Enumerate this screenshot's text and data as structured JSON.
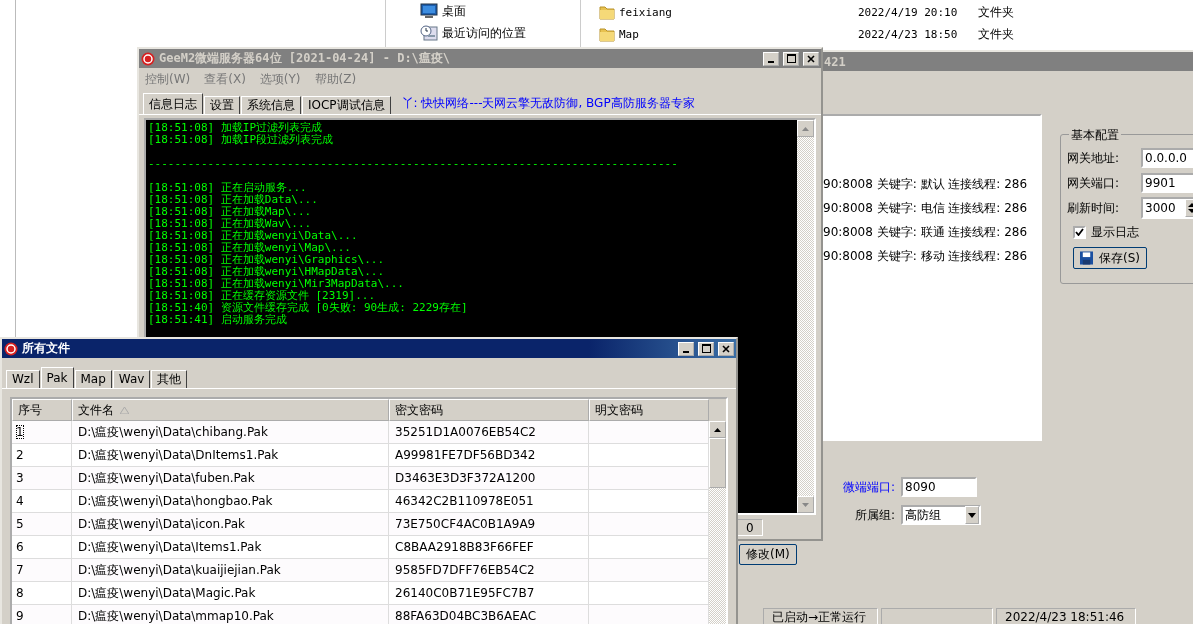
{
  "explorer": {
    "nav_items": [
      {
        "label": "桌面",
        "kind": "desktop"
      },
      {
        "label": "最近访问的位置",
        "kind": "recent"
      }
    ],
    "files": [
      {
        "name": "feixiang",
        "modified": "2022/4/19 20:10",
        "type": "文件夹"
      },
      {
        "name": "Map",
        "modified": "2022/4/23 18:50",
        "type": "文件夹"
      }
    ]
  },
  "gateway_window": {
    "title": "421",
    "connections": [
      "90:8008 关键字: 默认 连接线程: 286",
      "90:8008 关键字: 电信 连接线程: 286",
      "90:8008 关键字: 联通 连接线程: 286",
      "90:8008 关键字: 移动 连接线程: 286"
    ],
    "basic_config": {
      "title": "基本配置",
      "fields": [
        {
          "label": "网关地址:",
          "value": "0.0.0.0",
          "kind": "text"
        },
        {
          "label": "网关端口:",
          "value": "9901",
          "kind": "text"
        },
        {
          "label": "刷新时间:",
          "value": "3000",
          "kind": "spin"
        }
      ],
      "show_log": {
        "label": "显示日志",
        "checked": true
      },
      "save_button": "保存(S)"
    },
    "micro_port": {
      "label": "微端端口:",
      "value": "8090"
    },
    "group": {
      "label": "所属组:",
      "value": "高防组"
    },
    "modify_button": "修改(M)",
    "status_bar": [
      "已启动→正常运行",
      "2022/4/23 18:51:46"
    ]
  },
  "server_window": {
    "title": "GeeM2微端服务器64位 [2021-04-24] - D:\\瘟疫\\",
    "menu": [
      "控制(W)",
      "查看(X)",
      "选项(Y)",
      "帮助(Z)"
    ],
    "tabs": [
      {
        "label": "信息日志",
        "selected": true
      },
      {
        "label": "设置",
        "selected": false
      },
      {
        "label": "系统信息",
        "selected": false
      },
      {
        "label": "IOCP调试信息",
        "selected": false
      }
    ],
    "banner": "丫: 快快网络---天网云擎无敌防御, BGP高防服务器专家",
    "log": [
      {
        "kind": "line",
        "text": "[18:51:08] 加载IP过滤列表完成"
      },
      {
        "kind": "line",
        "text": "[18:51:08] 加载IP段过滤列表完成"
      },
      {
        "kind": "gap"
      },
      {
        "kind": "line",
        "text": "--------------------------------------------------------------------------------"
      },
      {
        "kind": "gap"
      },
      {
        "kind": "line",
        "text": "[18:51:08] 正在启动服务..."
      },
      {
        "kind": "line",
        "text": "[18:51:08] 正在加载Data\\..."
      },
      {
        "kind": "line",
        "text": "[18:51:08] 正在加载Map\\..."
      },
      {
        "kind": "line",
        "text": "[18:51:08] 正在加载Wav\\..."
      },
      {
        "kind": "line",
        "text": "[18:51:08] 正在加载wenyi\\Data\\..."
      },
      {
        "kind": "line",
        "text": "[18:51:08] 正在加载wenyi\\Map\\..."
      },
      {
        "kind": "line",
        "text": "[18:51:08] 正在加载wenyi\\Graphics\\..."
      },
      {
        "kind": "line",
        "text": "[18:51:08] 正在加载wenyi\\HMapData\\..."
      },
      {
        "kind": "line",
        "text": "[18:51:08] 正在加载wenyi\\Mir3MapData\\..."
      },
      {
        "kind": "line",
        "text": "[18:51:08] 正在缓存资源文件 [2319]..."
      },
      {
        "kind": "line",
        "text": "[18:51:40] 资源文件缓存完成 [0失败: 90生成: 2229存在]"
      },
      {
        "kind": "line",
        "text": "[18:51:41] 启动服务完成"
      }
    ],
    "status_bar": [
      "0"
    ]
  },
  "files_window": {
    "title": "所有文件",
    "tabs": [
      {
        "label": "Wzl",
        "selected": false
      },
      {
        "label": "Pak",
        "selected": true
      },
      {
        "label": "Map",
        "selected": false
      },
      {
        "label": "Wav",
        "selected": false
      },
      {
        "label": "其他",
        "selected": false
      }
    ],
    "table": {
      "columns": [
        {
          "label": "序号",
          "sorted": false
        },
        {
          "label": "文件名",
          "sorted": true
        },
        {
          "label": "密文密码",
          "sorted": false
        },
        {
          "label": "明文密码",
          "sorted": false
        }
      ],
      "rows": [
        {
          "index": "1",
          "file": "D:\\瘟疫\\wenyi\\Data\\chibang.Pak",
          "cipher": "35251D1A0076EB54C2",
          "focused": true
        },
        {
          "index": "2",
          "file": "D:\\瘟疫\\wenyi\\Data\\DnItems1.Pak",
          "cipher": "A99981FE7DF56BD342",
          "focused": false
        },
        {
          "index": "3",
          "file": "D:\\瘟疫\\wenyi\\Data\\fuben.Pak",
          "cipher": "D3463E3D3F372A1200",
          "focused": false
        },
        {
          "index": "4",
          "file": "D:\\瘟疫\\wenyi\\Data\\hongbao.Pak",
          "cipher": "46342C2B110978E051",
          "focused": false
        },
        {
          "index": "5",
          "file": "D:\\瘟疫\\wenyi\\Data\\icon.Pak",
          "cipher": "73E750CF4AC0B1A9A9",
          "focused": false
        },
        {
          "index": "6",
          "file": "D:\\瘟疫\\wenyi\\Data\\Items1.Pak",
          "cipher": "C8BAA2918B83F66FEF",
          "focused": false
        },
        {
          "index": "7",
          "file": "D:\\瘟疫\\wenyi\\Data\\kuaijiejian.Pak",
          "cipher": "9585FD7DFF76EB54C2",
          "focused": false
        },
        {
          "index": "8",
          "file": "D:\\瘟疫\\wenyi\\Data\\Magic.Pak",
          "cipher": "26140C0B71E95FC7B7",
          "focused": false
        },
        {
          "index": "9",
          "file": "D:\\瘟疫\\wenyi\\Data\\mmap10.Pak",
          "cipher": "88FA63D04BC3B6AEAC",
          "focused": false
        }
      ]
    }
  }
}
